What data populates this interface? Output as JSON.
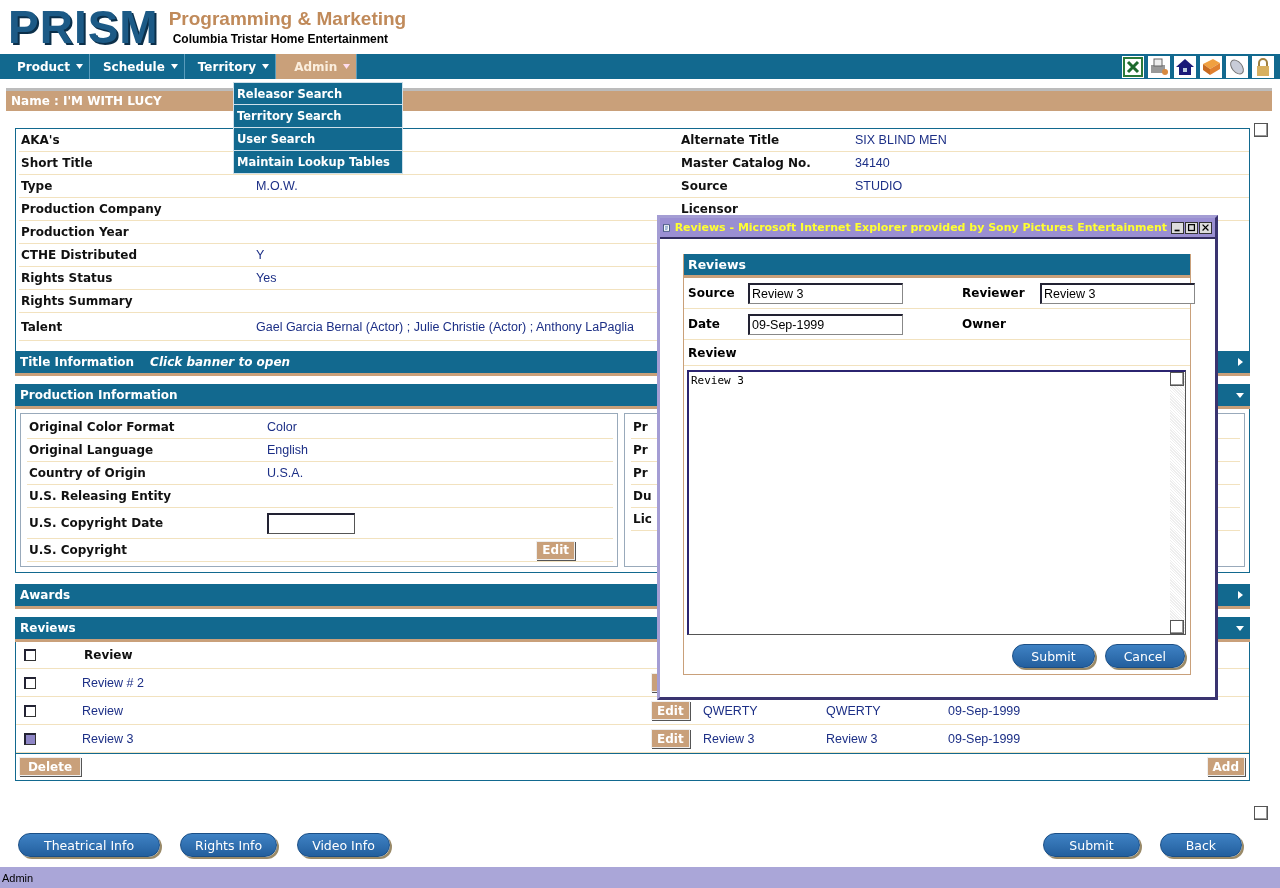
{
  "header": {
    "logo": "PRISM",
    "title": "Programming & Marketing",
    "subtitle": "Columbia Tristar Home Entertainment"
  },
  "menu": [
    {
      "label": "Product",
      "selected": false
    },
    {
      "label": "Schedule",
      "selected": false
    },
    {
      "label": "Territory",
      "selected": false
    },
    {
      "label": "Admin",
      "selected": true
    }
  ],
  "admin_menu": [
    "Releasor Search",
    "Territory Search",
    "User Search",
    "Maintain Lookup Tables"
  ],
  "name_bar": "Name : I'M WITH LUCY",
  "details_left": [
    {
      "label": "AKA's"
    },
    {
      "label": "Short Title"
    },
    {
      "label": "Type",
      "value": "M.O.W."
    },
    {
      "label": "Production Company"
    },
    {
      "label": "Production Year"
    },
    {
      "label": "CTHE Distributed",
      "value": "Y"
    },
    {
      "label": "Rights Status",
      "value": "Yes"
    },
    {
      "label": "Rights Summary"
    },
    {
      "label": "Talent",
      "value": "Gael Garcia Bernal (Actor) ; Julie Christie (Actor) ; Anthony LaPaglia"
    }
  ],
  "details_right": [
    {
      "label": "Alternate Title",
      "value": "SIX BLIND MEN"
    },
    {
      "label": "Master Catalog No.",
      "value": "34140"
    },
    {
      "label": "Source",
      "value": "STUDIO"
    },
    {
      "label": "Licensor"
    }
  ],
  "sections": [
    {
      "title": "Title Information",
      "hint": "Click banner to open",
      "expanded": false
    },
    {
      "title": "Production Information",
      "expanded": true
    },
    {
      "title": "Awards",
      "expanded": false
    },
    {
      "title": "Reviews",
      "expanded": true
    }
  ],
  "production_left": [
    {
      "kind": "text",
      "label": "Original Color Format",
      "value": "Color"
    },
    {
      "kind": "text",
      "label": "Original Language",
      "value": "English"
    },
    {
      "kind": "text",
      "label": "Country of Origin",
      "value": "U.S.A."
    },
    {
      "kind": "text",
      "label": "U.S. Releasing Entity"
    },
    {
      "kind": "input",
      "label": "U.S. Copyright Date"
    },
    {
      "kind": "edit",
      "label": "U.S. Copyright",
      "value": "Edit"
    }
  ],
  "production_right": [
    "Pr",
    "Pr",
    "Pr",
    "Du",
    "Lic"
  ],
  "reviews": {
    "header_checked": false,
    "column_label": "Review",
    "rows": [
      {
        "checked": false,
        "title": "Review # 2",
        "edit": "",
        "cells": []
      },
      {
        "checked": false,
        "title": "Review",
        "edit": "Edit",
        "cells": [
          "QWERTY",
          "QWERTY",
          "09-Sep-1999"
        ]
      },
      {
        "checked": true,
        "title": "Review 3",
        "edit": "Edit",
        "cells": [
          "Review 3",
          "Review 3",
          "09-Sep-1999"
        ]
      }
    ],
    "delete": "Delete",
    "add": "Add"
  },
  "bottom_left": [
    "Theatrical Info",
    "Rights Info",
    "Video Info"
  ],
  "bottom_right": [
    "Submit",
    "Back"
  ],
  "status_bar": "Admin",
  "popup": {
    "title": "Reviews - Microsoft Internet Explorer provided by Sony Pictures Entertainment",
    "panel_title": "Reviews",
    "source_label": "Source",
    "source": "Review 3",
    "reviewer_label": "Reviewer",
    "reviewer": "Review 3",
    "date_label": "Date",
    "date": "09-Sep-1999",
    "owner_label": "Owner",
    "review_label": "Review",
    "review": "Review 3",
    "buttons": [
      "Submit",
      "Cancel"
    ]
  }
}
